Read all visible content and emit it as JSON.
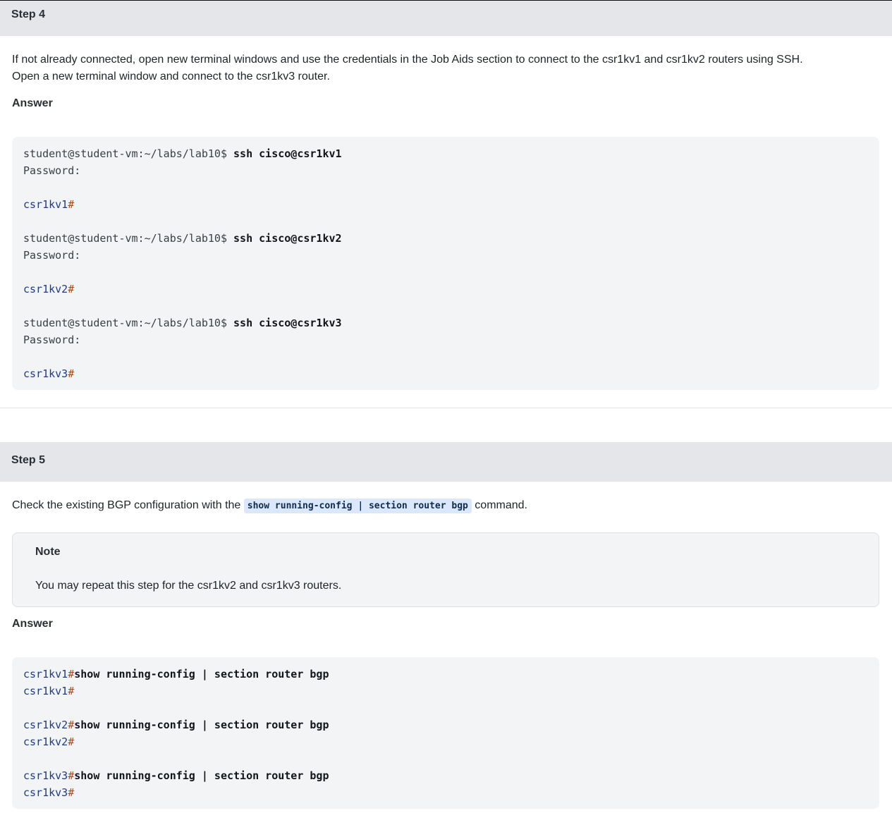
{
  "step4": {
    "title": "Step 4",
    "instruction_line1": "If not already connected, open new terminal windows and use the credentials in the Job Aids section to connect to the csr1kv1 and csr1kv2 routers using SSH.",
    "instruction_line2": "Open a new terminal window and connect to the csr1kv3 router.",
    "answer_label": "Answer",
    "code": [
      {
        "prompt": "student@student-vm:~/labs/lab10$ ",
        "cmd": "ssh cisco@csr1kv1"
      },
      {
        "text": "Password:"
      },
      {
        "host": "csr1kv1",
        "hash": "#"
      },
      {
        "prompt": "student@student-vm:~/labs/lab10$ ",
        "cmd": "ssh cisco@csr1kv2"
      },
      {
        "text": "Password:"
      },
      {
        "host": "csr1kv2",
        "hash": "#"
      },
      {
        "prompt": "student@student-vm:~/labs/lab10$ ",
        "cmd": "ssh cisco@csr1kv3"
      },
      {
        "text": "Password:"
      },
      {
        "host": "csr1kv3",
        "hash": "#"
      }
    ]
  },
  "step5": {
    "title": "Step 5",
    "instruction_before": "Check the existing BGP configuration with the ",
    "instruction_code": "show running-config | section router bgp",
    "instruction_after": " command.",
    "note": {
      "title": "Note",
      "text": "You may repeat this step for the csr1kv2 and csr1kv3 routers."
    },
    "answer_label": "Answer",
    "code": [
      {
        "host": "csr1kv1",
        "hash": "#",
        "cmd": "show running-config | section router bgp"
      },
      {
        "host": "csr1kv1",
        "hash": "#"
      },
      {
        "host": "csr1kv2",
        "hash": "#",
        "cmd": "show running-config | section router bgp"
      },
      {
        "host": "csr1kv2",
        "hash": "#"
      },
      {
        "host": "csr1kv3",
        "hash": "#",
        "cmd": "show running-config | section router bgp"
      },
      {
        "host": "csr1kv3",
        "hash": "#"
      }
    ]
  },
  "colors": {
    "header_bg": "#e5e6e9",
    "code_bg": "#f3f4f6",
    "host_blue": "#1e3a8a",
    "hash_orange": "#c2410c",
    "inline_code_bg": "#dbe8fb"
  }
}
